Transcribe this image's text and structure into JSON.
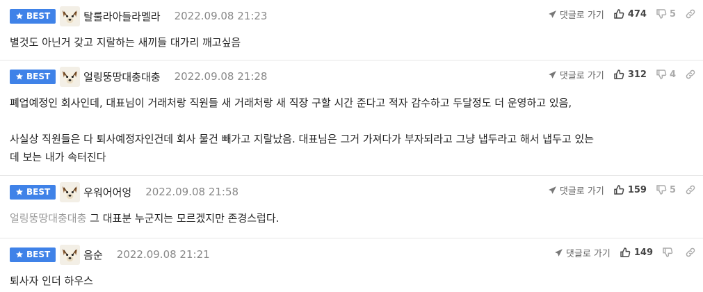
{
  "colors": {
    "best_badge": "#3f82e8",
    "date": "#888888",
    "mention": "#999999"
  },
  "icons": {
    "badge": "star-icon",
    "reply": "paper-plane-icon",
    "like": "thumbs-up-icon",
    "dislike": "thumbs-down-icon",
    "link": "link-icon"
  },
  "comments": [
    {
      "badge": "BEST",
      "nickname": "탈룰라아들라멜라",
      "date": "2022.09.08 21:23",
      "reply_label": "댓글로 가기",
      "likes": "474",
      "dislikes": "5",
      "avatar": "dog-avatar",
      "lines": [
        "별것도 아닌거 갖고 지랄하는 새끼들 대가리 깨고싶음"
      ]
    },
    {
      "badge": "BEST",
      "nickname": "얼링뚱땅대충대충",
      "date": "2022.09.08 21:28",
      "reply_label": "댓글로 가기",
      "likes": "312",
      "dislikes": "4",
      "avatar": "dog-avatar",
      "lines": [
        "폐업예정인 회사인데, 대표님이 거래처랑 직원들 새 거래처랑 새 직장 구할 시간 준다고 적자 감수하고 두달정도 더 운영하고 있음,",
        "사실상 직원들은 다 퇴사예정자인건데 회사 물건 빼가고 지랄났음. 대표님은 그거 가져다가 부자되라고 그냥 냅두라고 해서 냅두고 있는",
        "데 보는 내가 속터진다"
      ]
    },
    {
      "badge": "BEST",
      "nickname": "우워어어엉",
      "date": "2022.09.08 21:58",
      "reply_label": "댓글로 가기",
      "likes": "159",
      "dislikes": "5",
      "avatar": "dog-avatar",
      "mention": "얼링뚱땅대충대충",
      "text": " 그 대표분 누군지는 모르겠지만 존경스럽다."
    },
    {
      "badge": "BEST",
      "nickname": "음순",
      "date": "2022.09.08 21:21",
      "reply_label": "댓글로 가기",
      "likes": "149",
      "dislikes": "",
      "avatar": "dog-avatar",
      "lines": [
        "퇴사자 인더 하우스"
      ]
    }
  ]
}
